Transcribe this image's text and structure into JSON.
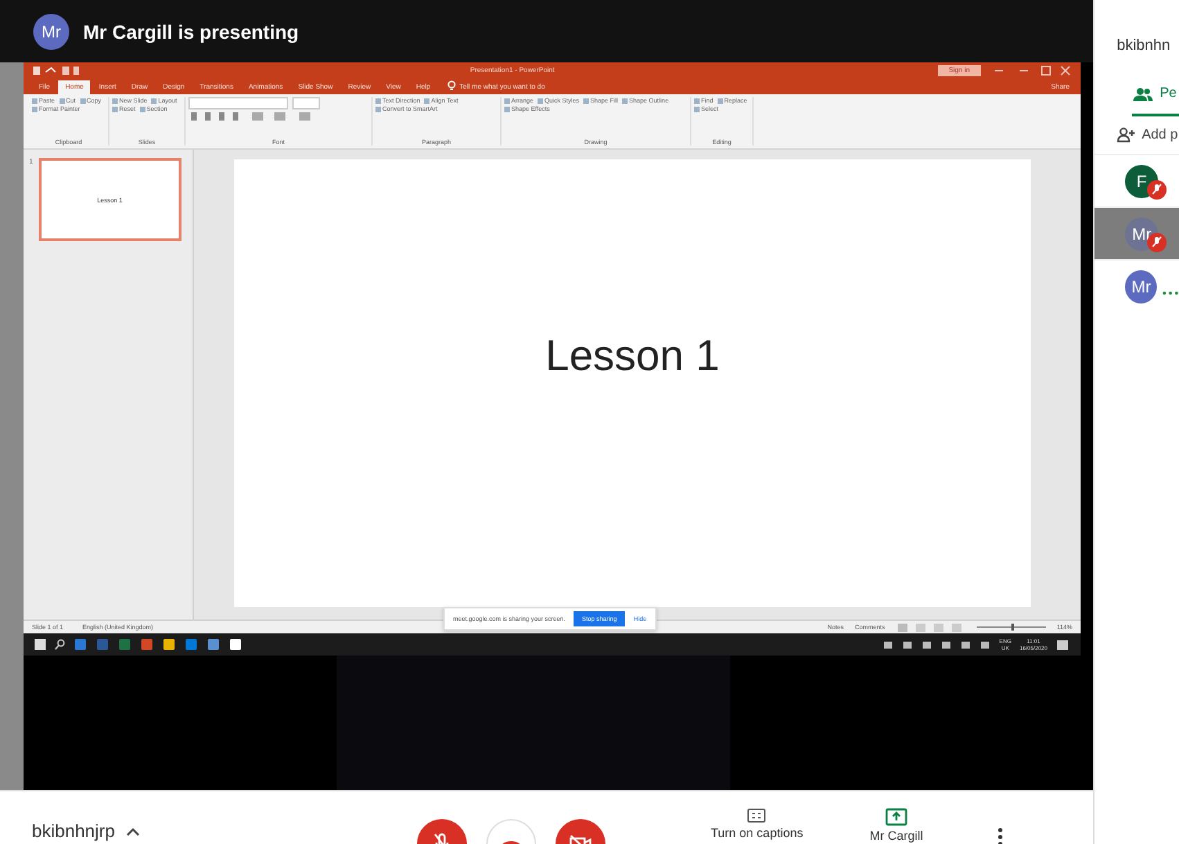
{
  "header": {
    "avatar": "Mr",
    "title": "Mr Cargill is presenting"
  },
  "powerpoint": {
    "window_title": "Presentation1 - PowerPoint",
    "sign_in": "Sign in",
    "tabs": [
      {
        "label": "File",
        "selected": false
      },
      {
        "label": "Home",
        "selected": true
      },
      {
        "label": "Insert",
        "selected": false
      },
      {
        "label": "Draw",
        "selected": false
      },
      {
        "label": "Design",
        "selected": false
      },
      {
        "label": "Transitions",
        "selected": false
      },
      {
        "label": "Animations",
        "selected": false
      },
      {
        "label": "Slide Show",
        "selected": false
      },
      {
        "label": "Review",
        "selected": false
      },
      {
        "label": "View",
        "selected": false
      },
      {
        "label": "Help",
        "selected": false
      }
    ],
    "tell_me": "Tell me what you want to do",
    "share": "Share",
    "ribbon_groups": [
      {
        "label": "Clipboard",
        "items": [
          "Paste",
          "Cut",
          "Copy",
          "Format Painter"
        ]
      },
      {
        "label": "Slides",
        "items": [
          "New Slide",
          "Layout",
          "Reset",
          "Section"
        ]
      },
      {
        "label": "Font",
        "kind": "font"
      },
      {
        "label": "Paragraph",
        "items": [
          "Text Direction",
          "Align Text",
          "Convert to SmartArt"
        ]
      },
      {
        "label": "Drawing",
        "items": [
          "Arrange",
          "Quick Styles",
          "Shape Fill",
          "Shape Outline",
          "Shape Effects"
        ]
      },
      {
        "label": "Editing",
        "items": [
          "Find",
          "Replace",
          "Select"
        ]
      }
    ],
    "thumbnail": {
      "number": "1",
      "text": "Lesson 1",
      "selected": true
    },
    "slide_title": "Lesson 1",
    "status_bar": {
      "slide": "Slide 1 of 1",
      "language": "English (United Kingdom)",
      "notes": "Notes",
      "comments": "Comments",
      "zoom_slider": {
        "level": 0.5
      },
      "zoom": "114%"
    },
    "sharing_bar": {
      "message": "meet.google.com is sharing your screen.",
      "stop": "Stop sharing",
      "hide": "Hide"
    },
    "taskbar": {
      "lang": "ENG",
      "region": "UK",
      "time": "11:01",
      "date": "16/05/2020"
    }
  },
  "bottom_bar": {
    "meeting_code": "bkibnhnjrp",
    "mic_muted": true,
    "camera_off": true,
    "captions": "Turn on captions",
    "presenter": "Mr Cargill"
  },
  "side_panel": {
    "meeting_code": "bkibnhn",
    "tab": "Pe",
    "add": "Add p",
    "participants": [
      {
        "initial": "F",
        "color": "#0d5c3a",
        "muted": true,
        "selected": false
      },
      {
        "initial": "Mr",
        "color": "#6e7394",
        "muted": true,
        "selected": true
      },
      {
        "initial": "Mr",
        "color": "#5c6bc0",
        "muted": false,
        "selected": false
      }
    ]
  }
}
